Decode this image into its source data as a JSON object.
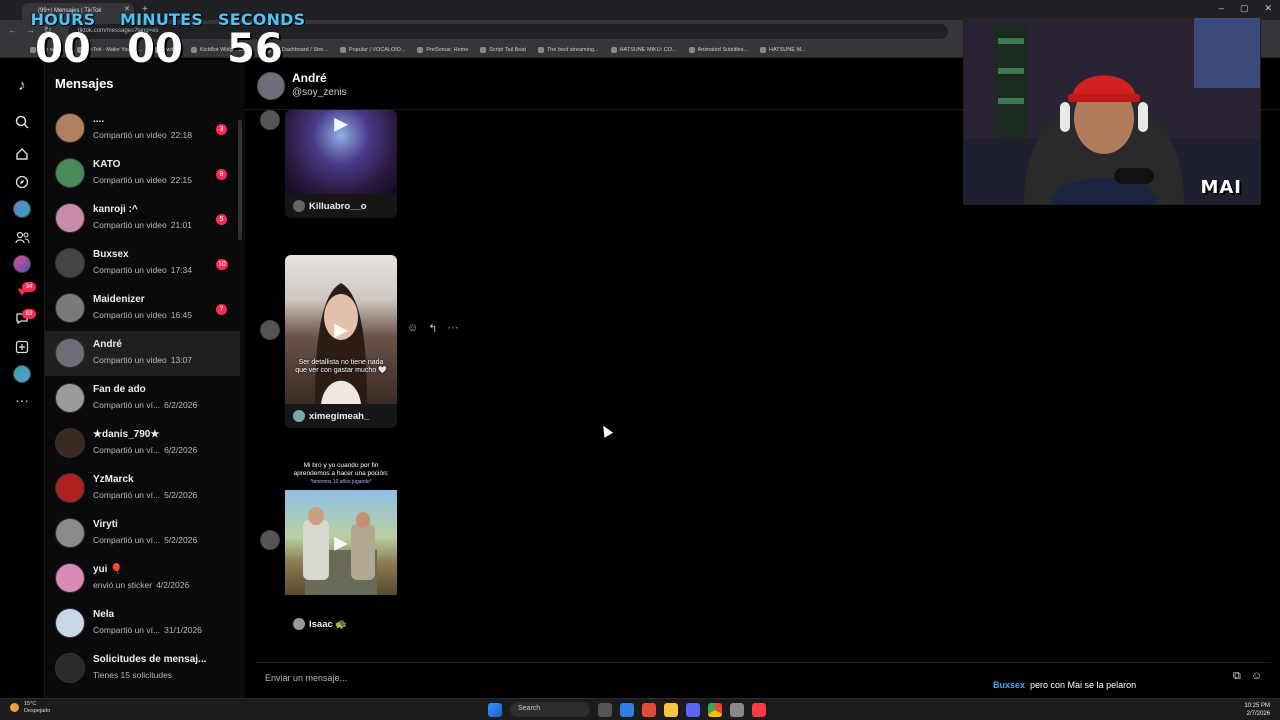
{
  "browser": {
    "tab_title": "(99+) Mensajes | TikTok",
    "url": "tiktok.com/messages?lang=es",
    "bookmarks": [
      "The worl...",
      "TikTok - Make Your D...",
      "Twitch",
      "KickBot Widget Buil...",
      "(3) Dashboard / Stre...",
      "Popular | VOCALOID...",
      "PreSonus: Home",
      "Script Tail Beat",
      "The best streaming...",
      "HATSUNE MIKU: CO...",
      "Animated Subtitles...",
      "HATSUNE M..."
    ]
  },
  "timer": {
    "hours_label": "HOURS",
    "minutes_label": "MINUTES",
    "seconds_label": "SECONDS",
    "hours": "00",
    "minutes": "00",
    "seconds": "56"
  },
  "rail": {
    "notification_badge": "34",
    "messages_badge": "83"
  },
  "sidebar": {
    "title": "Mensajes",
    "conversations": [
      {
        "name": "....",
        "preview": "Compartió un video",
        "time": "22:18",
        "badge": "3",
        "color": "#b08060"
      },
      {
        "name": "KATO",
        "preview": "Compartió un video",
        "time": "22:15",
        "badge": "9",
        "color": "#4a8a5a"
      },
      {
        "name": "kanroji :^",
        "preview": "Compartió un video",
        "time": "21:01",
        "badge": "5",
        "color": "#c98aa8"
      },
      {
        "name": "Buxsex",
        "preview": "Compartió un video",
        "time": "17:34",
        "badge": "10",
        "color": "#444444"
      },
      {
        "name": "Maidenizer",
        "preview": "Compartió un video",
        "time": "16:45",
        "badge": "7",
        "color": "#7a7a7a"
      },
      {
        "name": "André",
        "preview": "Compartió un video",
        "time": "13:07",
        "badge": "",
        "color": "#6e6e7a"
      },
      {
        "name": "Fan de ado",
        "preview": "Compartió un ví...",
        "time": "6/2/2026",
        "badge": "",
        "color": "#9a9a9a"
      },
      {
        "name": "★danis_790★",
        "preview": "Compartió un ví...",
        "time": "6/2/2026",
        "badge": "",
        "color": "#3a2a20"
      },
      {
        "name": "YzMarck",
        "preview": "Compartió un ví...",
        "time": "5/2/2026",
        "badge": "",
        "color": "#b02020"
      },
      {
        "name": "Viryti",
        "preview": "Compartió un ví...",
        "time": "5/2/2026",
        "badge": "",
        "color": "#8a8a8a"
      },
      {
        "name": "yui 🎈",
        "preview": "envió un sticker",
        "time": "4/2/2026",
        "badge": "",
        "color": "#d98ab8"
      },
      {
        "name": "Nela",
        "preview": "Compartió un ví...",
        "time": "31/1/2026",
        "badge": "",
        "color": "#c8d8e8"
      },
      {
        "name": "Solicitudes de mensaj...",
        "preview": "Tienes 15 solicitudes",
        "time": "",
        "badge": "",
        "color": "#2a2a2a"
      }
    ]
  },
  "chat": {
    "name": "André",
    "handle": "@soy_zenis",
    "messages": [
      {
        "author": "Killuabro__o"
      },
      {
        "author": "ximegimeah_",
        "caption": "Ser detallista no tiene nada que ver con gastar mucho 🤍"
      },
      {
        "author": "Isaac 🐢",
        "caption": "Mi bro y yo cuando por fin aprendemos a hacer una poción:",
        "subcaption": "*tenemos 10 años jugando*"
      }
    ],
    "composer_placeholder": "Enviar un mensaje..."
  },
  "overlay_chat": {
    "user": "Buxsex",
    "text": "pero con Mai se la pelaron"
  },
  "cam": {
    "tag": "MAI"
  },
  "taskbar": {
    "weather_temp": "15°C",
    "weather_desc": "Despejado",
    "search": "Search",
    "time": "10:25 PM",
    "date": "2/7/2026"
  }
}
